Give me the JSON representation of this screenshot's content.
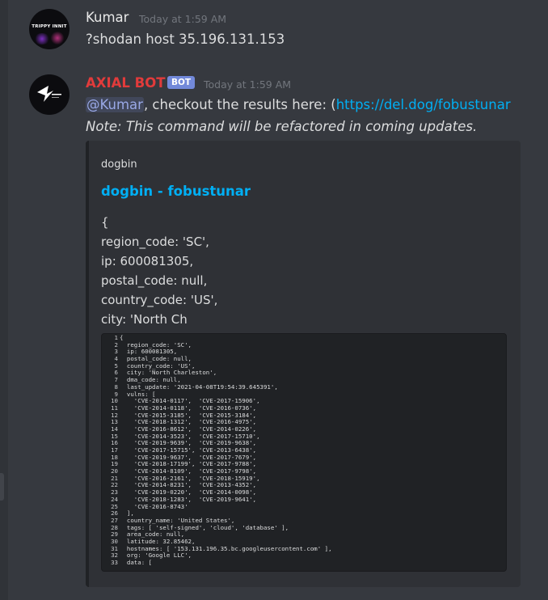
{
  "messages": [
    {
      "avatar_text": "TRIPPY INNIT",
      "author": "Kumar",
      "timestamp": "Today at 1:59 AM",
      "content": "?shodan host 35.196.131.153"
    },
    {
      "author": "AXIAL BOT",
      "badge": "BOT",
      "timestamp": "Today at 1:59 AM",
      "mention": "@Kumar",
      "text_before_link": ", checkout the results here: (",
      "link": "https://del.dog/fobustunar",
      "note": "Note: This command will be refactored in coming updates.",
      "embed": {
        "provider": "dogbin",
        "title": "dogbin - fobustunar",
        "description": [
          "{",
          "region_code: 'SC',",
          "ip: 600081305,",
          "postal_code: null,",
          "country_code: 'US',",
          "city: 'North Ch"
        ],
        "code_lines": [
          {
            "n": "1",
            "text": "{"
          },
          {
            "n": "2",
            "text": "  region_code: 'SC',"
          },
          {
            "n": "3",
            "text": "  ip: 600081305,"
          },
          {
            "n": "4",
            "text": "  postal_code: null,"
          },
          {
            "n": "5",
            "text": "  country_code: 'US',"
          },
          {
            "n": "6",
            "text": "  city: 'North Charleston',"
          },
          {
            "n": "7",
            "text": "  dma_code: null,"
          },
          {
            "n": "8",
            "text": "  last_update: '2021-04-08T19:54:39.645391',"
          },
          {
            "n": "9",
            "text": "  vulns: ["
          },
          {
            "n": "10",
            "text": "    'CVE-2014-0117',  'CVE-2017-15906',"
          },
          {
            "n": "11",
            "text": "    'CVE-2014-0118',  'CVE-2016-0736',"
          },
          {
            "n": "12",
            "text": "    'CVE-2015-3185',  'CVE-2015-3184',"
          },
          {
            "n": "13",
            "text": "    'CVE-2018-1312',  'CVE-2016-4975',"
          },
          {
            "n": "14",
            "text": "    'CVE-2016-8612',  'CVE-2014-0226',"
          },
          {
            "n": "15",
            "text": "    'CVE-2014-3523',  'CVE-2017-15710',"
          },
          {
            "n": "16",
            "text": "    'CVE-2019-9639',  'CVE-2019-9638',"
          },
          {
            "n": "17",
            "text": "    'CVE-2017-15715', 'CVE-2013-6438',"
          },
          {
            "n": "18",
            "text": "    'CVE-2019-9637',  'CVE-2017-7679',"
          },
          {
            "n": "19",
            "text": "    'CVE-2018-17199', 'CVE-2017-9788',"
          },
          {
            "n": "20",
            "text": "    'CVE-2014-8109',  'CVE-2017-9798',"
          },
          {
            "n": "21",
            "text": "    'CVE-2016-2161',  'CVE-2018-15919',"
          },
          {
            "n": "22",
            "text": "    'CVE-2014-8231',  'CVE-2013-4352',"
          },
          {
            "n": "23",
            "text": "    'CVE-2019-0220',  'CVE-2014-0098',"
          },
          {
            "n": "24",
            "text": "    'CVE-2018-1283',  'CVE-2019-9641',"
          },
          {
            "n": "25",
            "text": "    'CVE-2016-8743'"
          },
          {
            "n": "26",
            "text": "  ],"
          },
          {
            "n": "27",
            "text": "  country_name: 'United States',"
          },
          {
            "n": "28",
            "text": "  tags: [ 'self-signed', 'cloud', 'database' ],"
          },
          {
            "n": "29",
            "text": "  area_code: null,"
          },
          {
            "n": "30",
            "text": "  latitude: 32.85462,"
          },
          {
            "n": "31",
            "text": "  hostnames: [ '153.131.196.35.bc.googleusercontent.com' ],"
          },
          {
            "n": "32",
            "text": "  org: 'Google LLC',"
          },
          {
            "n": "33",
            "text": "  data: ["
          }
        ]
      }
    }
  ],
  "colors": {
    "background": "#36393f",
    "embed_background": "#2f3136",
    "code_background": "#202225",
    "bot_name": "#e23b3b",
    "bot_badge": "#7289da",
    "link": "#00aff4",
    "mention": "#99a8e6",
    "timestamp": "#72767d",
    "text": "#dcddde"
  },
  "icons": {
    "avatar_1": "trippy-innit-avatar",
    "avatar_2": "axial-logo-avatar"
  }
}
